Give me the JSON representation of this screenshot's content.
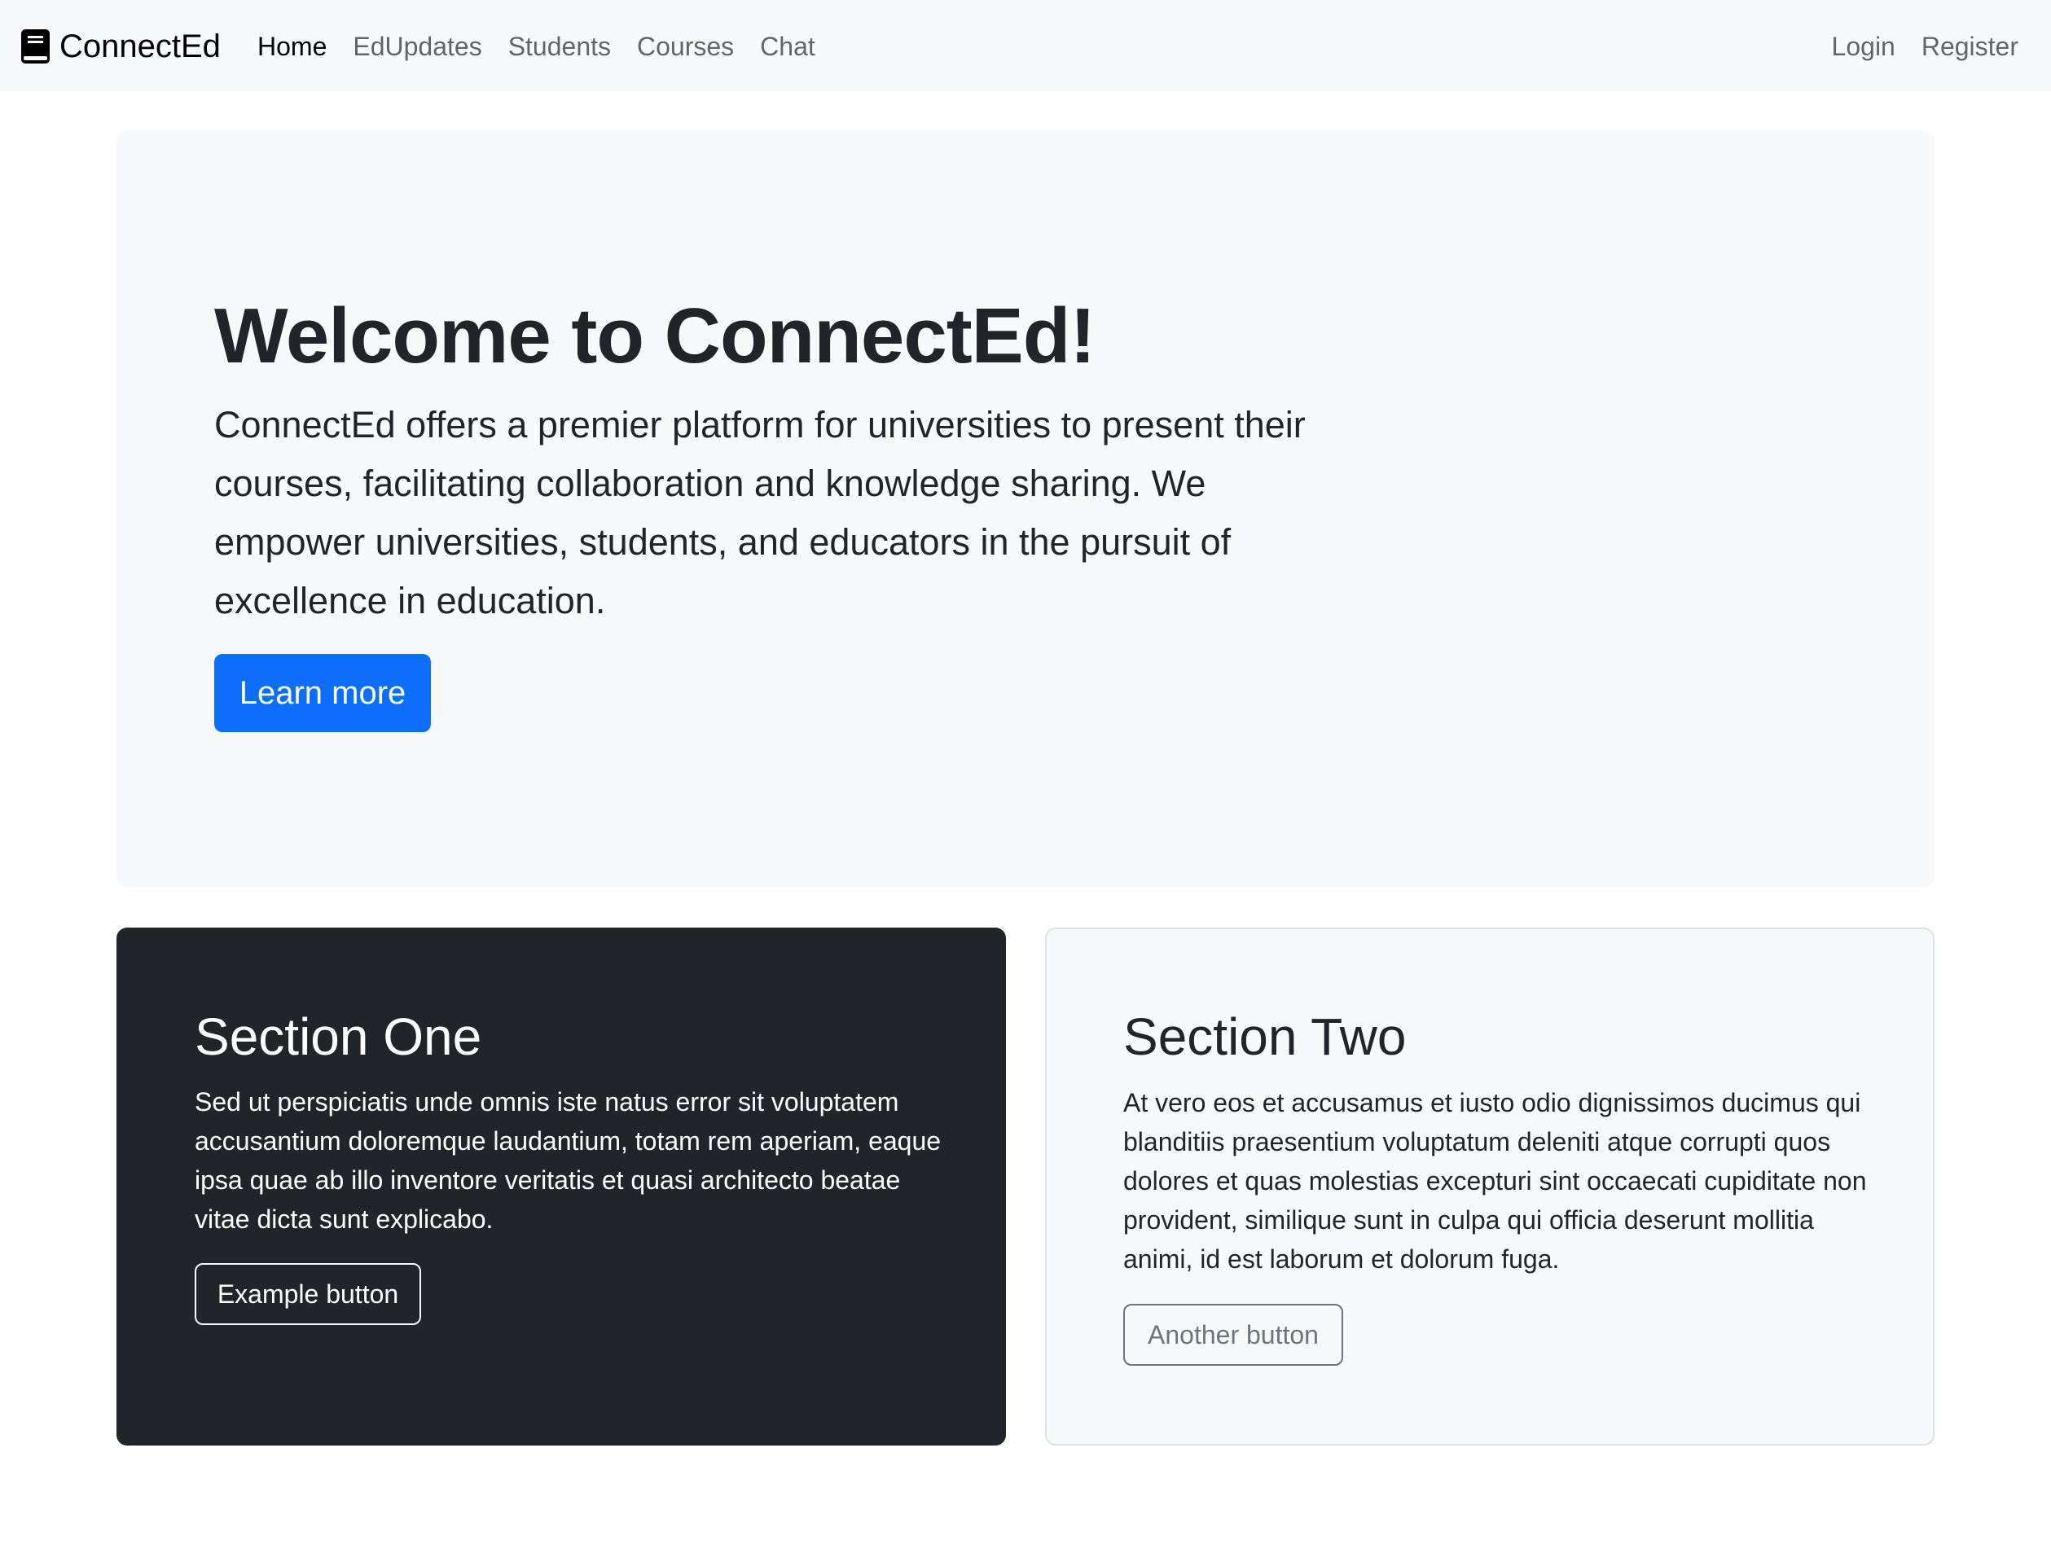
{
  "navbar": {
    "brand": "ConnectEd",
    "brand_icon": "book-icon",
    "links": [
      {
        "label": "Home",
        "active": true
      },
      {
        "label": "EdUpdates",
        "active": false
      },
      {
        "label": "Students",
        "active": false
      },
      {
        "label": "Courses",
        "active": false
      },
      {
        "label": "Chat",
        "active": false
      }
    ],
    "right_links": [
      {
        "label": "Login"
      },
      {
        "label": "Register"
      }
    ]
  },
  "hero": {
    "title": "Welcome to ConnectEd!",
    "text": "ConnectEd offers a premier platform for universities to present their courses, facilitating collaboration and knowledge sharing. We empower universities, students, and educators in the pursuit of excellence in education.",
    "button_label": "Learn more"
  },
  "sections": [
    {
      "title": "Section One",
      "text": "Sed ut perspiciatis unde omnis iste natus error sit voluptatem accusantium doloremque laudantium, totam rem aperiam, eaque ipsa quae ab illo inventore veritatis et quasi architecto beatae vitae dicta sunt explicabo.",
      "button_label": "Example button"
    },
    {
      "title": "Section Two",
      "text": "At vero eos et accusamus et iusto odio dignissimos ducimus qui blanditiis praesentium voluptatum deleniti atque corrupti quos dolores et quas molestias excepturi sint occaecati cupiditate non provident, similique sunt in culpa qui officia deserunt mollitia animi, id est laborum et dolorum fuga.",
      "button_label": "Another button"
    }
  ],
  "colors": {
    "primary": "#0d6efd",
    "dark": "#212529",
    "light": "#f8f9fa",
    "secondary": "#6c757d"
  }
}
